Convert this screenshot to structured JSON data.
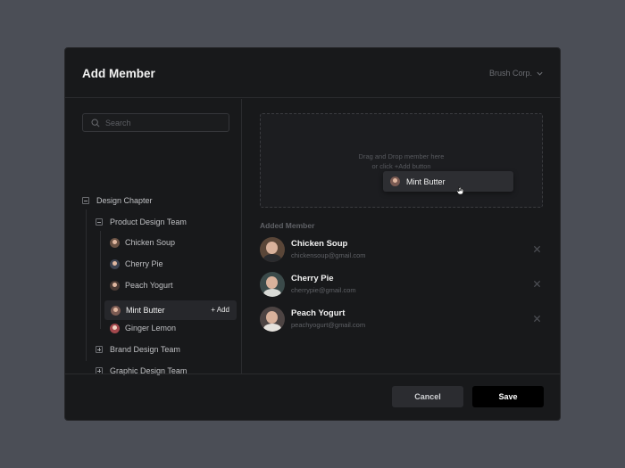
{
  "modal": {
    "title": "Add Member",
    "org_selector": "Brush Corp."
  },
  "search": {
    "placeholder": "Search"
  },
  "tree": {
    "chapter": "Design Chapter",
    "product_team": "Product Design Team",
    "members": [
      {
        "name": "Chicken Soup"
      },
      {
        "name": "Cherry Pie"
      },
      {
        "name": "Peach Yogurt"
      },
      {
        "name": "Mint Butter",
        "add_label": "+ Add"
      },
      {
        "name": "Ginger Lemon"
      }
    ],
    "brand_team": "Brand Design Team",
    "graphic_team": "Graphic Design Team"
  },
  "dropzone": {
    "line1": "Drag and Drop member here",
    "line2": "or click +Add button",
    "dragging": "Mint Butter"
  },
  "added": {
    "label": "Added Member",
    "members": [
      {
        "name": "Chicken Soup",
        "email": "chickensoup@gmail.com"
      },
      {
        "name": "Cherry Pie",
        "email": "cherrypie@gmail.com"
      },
      {
        "name": "Peach Yogurt",
        "email": "peachyogurt@gmail.com"
      }
    ]
  },
  "footer": {
    "cancel": "Cancel",
    "save": "Save"
  },
  "icons": {
    "search": "search-icon",
    "chevron": "chevron-down-icon",
    "remove": "close-icon",
    "cursor": "hand-cursor-icon"
  }
}
